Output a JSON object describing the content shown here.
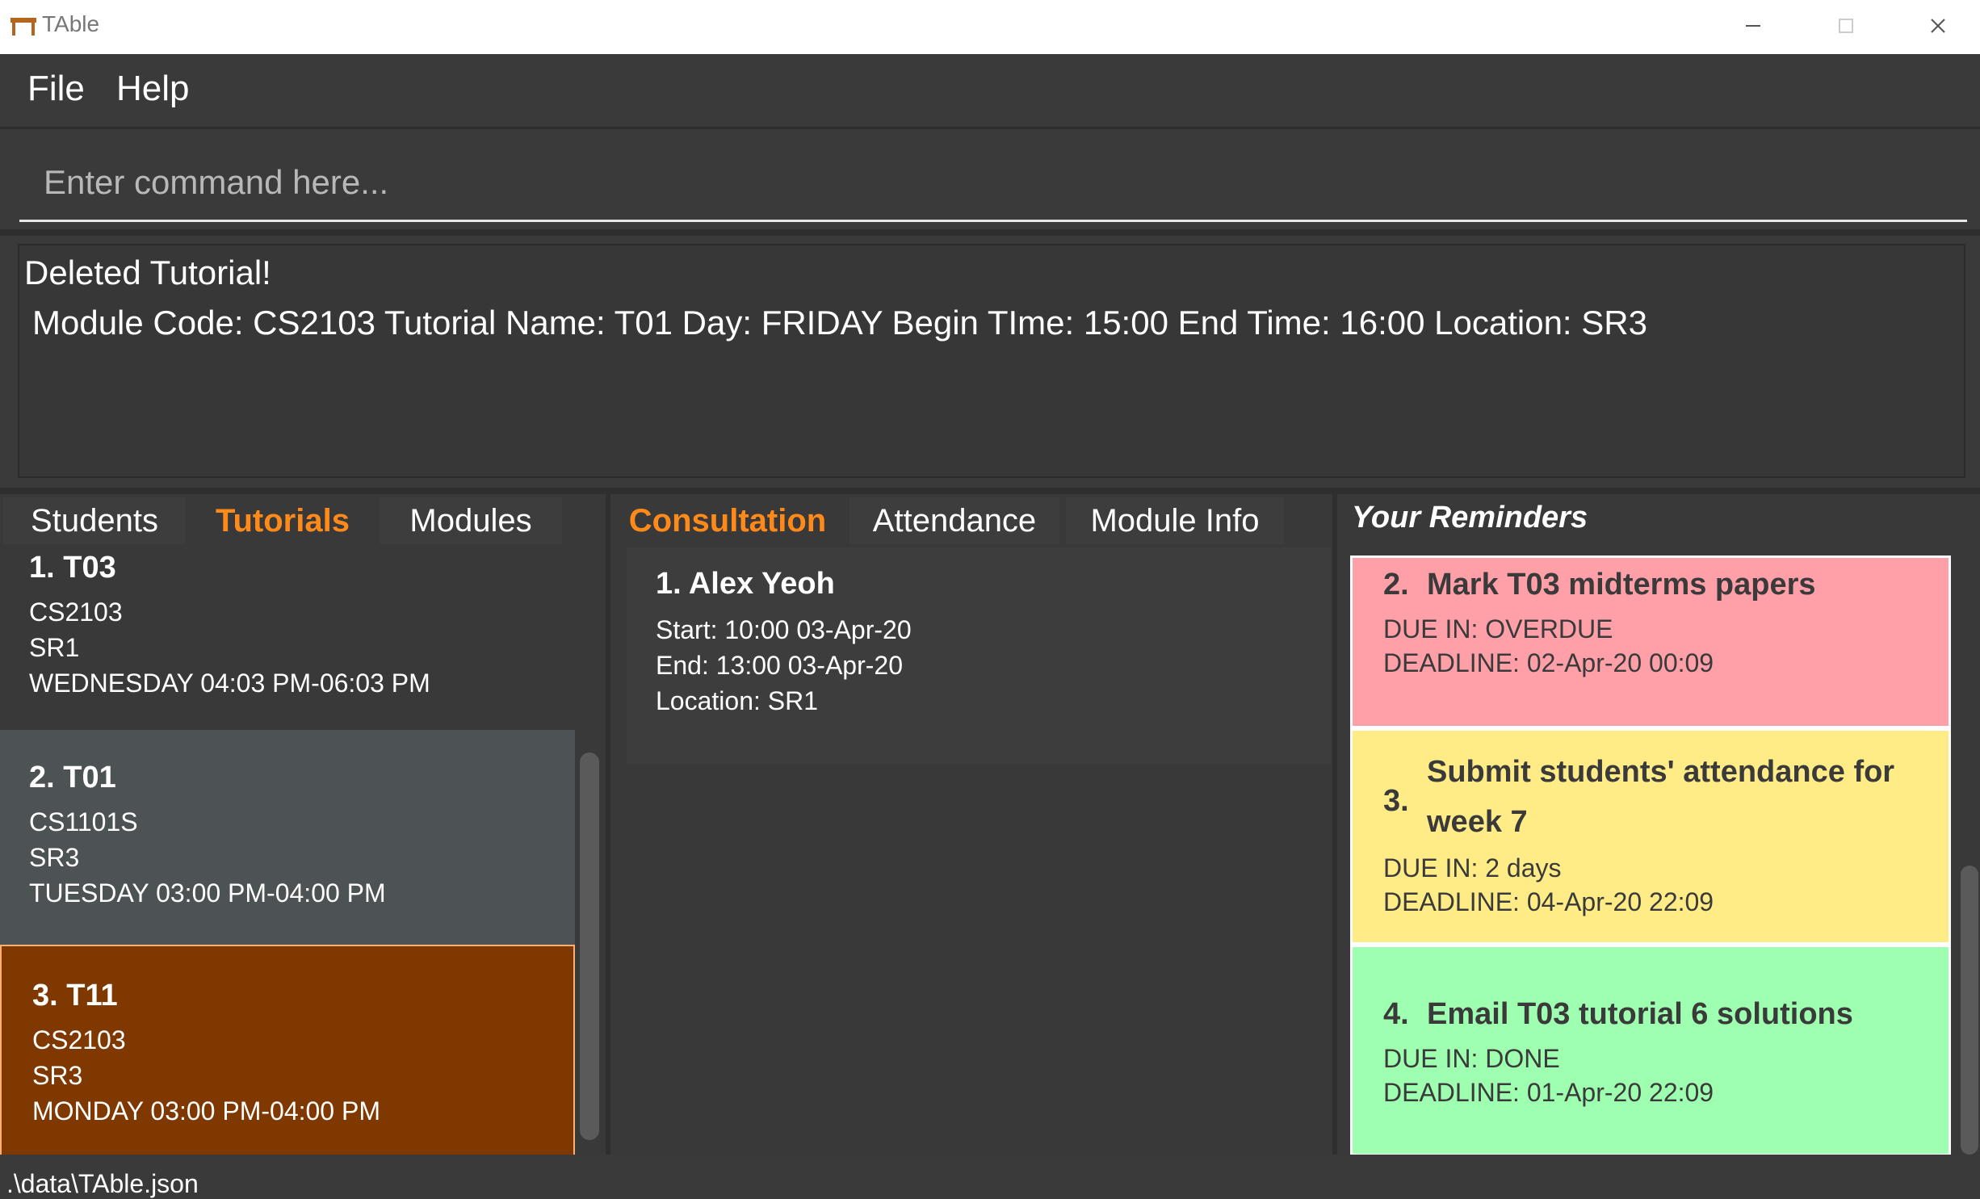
{
  "window": {
    "title": "TAble"
  },
  "menu": {
    "file": "File",
    "help": "Help"
  },
  "command": {
    "placeholder": "Enter command here...",
    "value": ""
  },
  "result": {
    "line1": "Deleted Tutorial!",
    "line2": "Module Code: CS2103 Tutorial Name: T01 Day: FRIDAY Begin TIme: 15:00 End Time: 16:00 Location: SR3"
  },
  "left_tabs": [
    "Students",
    "Tutorials",
    "Modules"
  ],
  "tutorials": [
    {
      "title": "1.  T03",
      "module": "CS2103",
      "location": "SR1",
      "time": "WEDNESDAY 04:03 PM-06:03 PM"
    },
    {
      "title": "2.  T01",
      "module": "CS1101S",
      "location": "SR3",
      "time": "TUESDAY 03:00 PM-04:00 PM"
    },
    {
      "title": "3.  T11",
      "module": "CS2103",
      "location": "SR3",
      "time": "MONDAY 03:00 PM-04:00 PM"
    }
  ],
  "mid_tabs": [
    "Consultation",
    "Attendance",
    "Module Info"
  ],
  "consultation": {
    "title": "1.  Alex Yeoh",
    "start": "Start: 10:00 03-Apr-20",
    "end": "End: 13:00 03-Apr-20",
    "location": "Location: SR1"
  },
  "reminders": {
    "heading": "Your Reminders",
    "items": [
      {
        "num": "2.",
        "text": "Mark T03 midterms papers",
        "due": "DUE IN: OVERDUE",
        "deadline": "DEADLINE: 02-Apr-20 00:09",
        "color": "#ffa0a8"
      },
      {
        "num": "3.",
        "text_line1": "Submit students' attendance for",
        "text_line2": "week 7",
        "due": "DUE IN: 2 days",
        "deadline": "DEADLINE: 04-Apr-20 22:09",
        "color": "#ffec87"
      },
      {
        "num": "4.",
        "text": "Email T03 tutorial 6 solutions",
        "due": "DUE IN: DONE",
        "deadline": "DEADLINE: 01-Apr-20 22:09",
        "color": "#9effb0"
      }
    ]
  },
  "status": {
    "path": ".\\data\\TAble.json"
  },
  "colors": {
    "accent": "#ff8a1a",
    "selected_card": "#7f3800",
    "hover_card": "#4d5254",
    "background": "#3a3a3a"
  }
}
